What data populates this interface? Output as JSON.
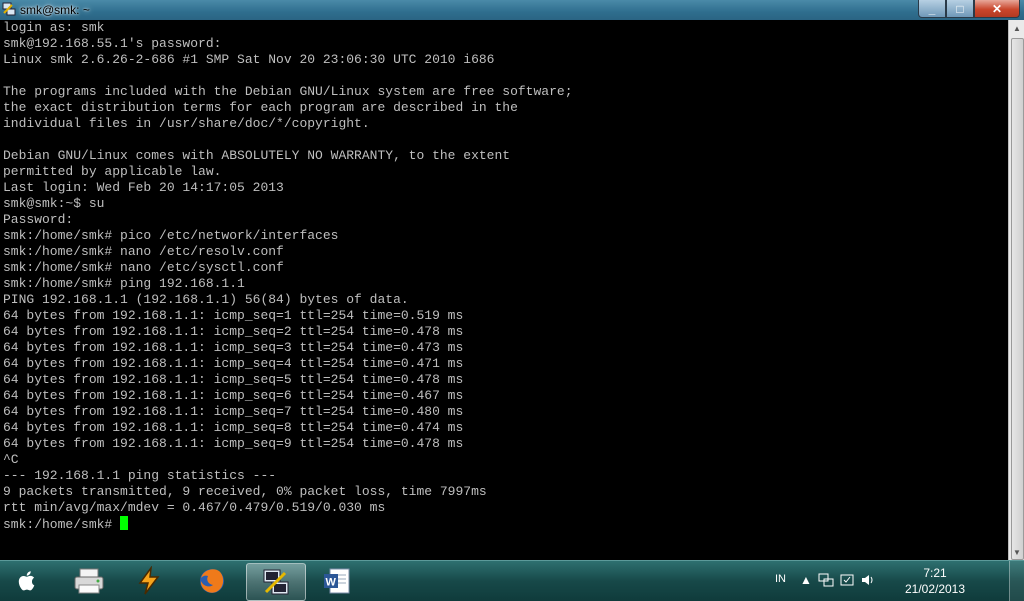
{
  "window": {
    "title": "smk@smk: ~",
    "controls": {
      "minimize": "_",
      "maximize": "□",
      "close": "✕"
    }
  },
  "terminal": {
    "lines": [
      "login as: smk",
      "smk@192.168.55.1's password:",
      "Linux smk 2.6.26-2-686 #1 SMP Sat Nov 20 23:06:30 UTC 2010 i686",
      "",
      "The programs included with the Debian GNU/Linux system are free software;",
      "the exact distribution terms for each program are described in the",
      "individual files in /usr/share/doc/*/copyright.",
      "",
      "Debian GNU/Linux comes with ABSOLUTELY NO WARRANTY, to the extent",
      "permitted by applicable law.",
      "Last login: Wed Feb 20 14:17:05 2013",
      "smk@smk:~$ su",
      "Password:",
      "smk:/home/smk# pico /etc/network/interfaces",
      "smk:/home/smk# nano /etc/resolv.conf",
      "smk:/home/smk# nano /etc/sysctl.conf",
      "smk:/home/smk# ping 192.168.1.1",
      "PING 192.168.1.1 (192.168.1.1) 56(84) bytes of data.",
      "64 bytes from 192.168.1.1: icmp_seq=1 ttl=254 time=0.519 ms",
      "64 bytes from 192.168.1.1: icmp_seq=2 ttl=254 time=0.478 ms",
      "64 bytes from 192.168.1.1: icmp_seq=3 ttl=254 time=0.473 ms",
      "64 bytes from 192.168.1.1: icmp_seq=4 ttl=254 time=0.471 ms",
      "64 bytes from 192.168.1.1: icmp_seq=5 ttl=254 time=0.478 ms",
      "64 bytes from 192.168.1.1: icmp_seq=6 ttl=254 time=0.467 ms",
      "64 bytes from 192.168.1.1: icmp_seq=7 ttl=254 time=0.480 ms",
      "64 bytes from 192.168.1.1: icmp_seq=8 ttl=254 time=0.474 ms",
      "64 bytes from 192.168.1.1: icmp_seq=9 ttl=254 time=0.478 ms",
      "^C",
      "--- 192.168.1.1 ping statistics ---",
      "9 packets transmitted, 9 received, 0% packet loss, time 7997ms",
      "rtt min/avg/max/mdev = 0.467/0.479/0.519/0.030 ms"
    ],
    "prompt": "smk:/home/smk# ",
    "cursor_color": "#00ff00"
  },
  "taskbar": {
    "items": [
      {
        "icon": "apple-start-icon"
      },
      {
        "icon": "printer-icon"
      },
      {
        "icon": "winamp-icon"
      },
      {
        "icon": "firefox-icon"
      },
      {
        "icon": "putty-icon",
        "active": true
      },
      {
        "icon": "word-icon"
      }
    ],
    "language": "IN",
    "tray_icons": [
      "show-hidden-icons-icon",
      "network-icon",
      "action-center-icon",
      "volume-icon"
    ],
    "clock": {
      "time": "7:21",
      "date": "21/02/2013"
    }
  }
}
